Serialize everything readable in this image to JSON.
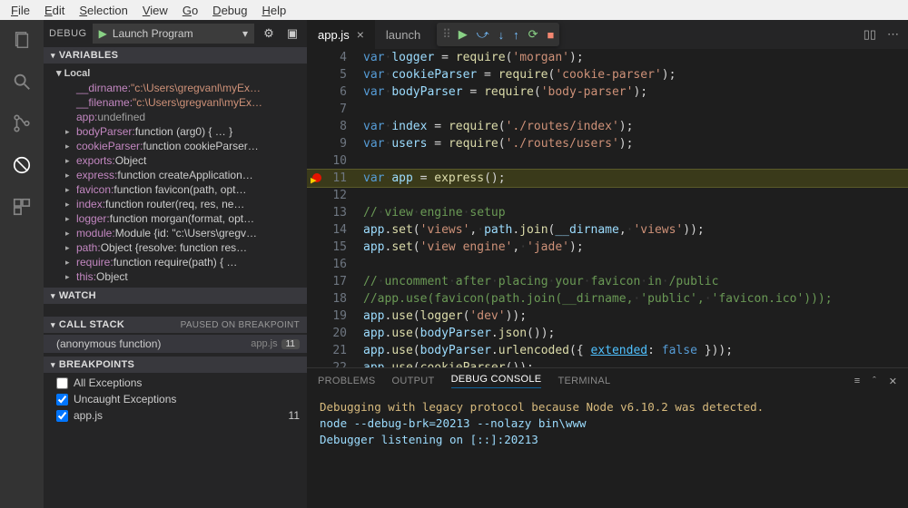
{
  "menubar": [
    "File",
    "Edit",
    "Selection",
    "View",
    "Go",
    "Debug",
    "Help"
  ],
  "debugHeader": {
    "label": "DEBUG",
    "config": "Launch Program"
  },
  "sections": {
    "variables": "VARIABLES",
    "localScope": "Local",
    "watch": "WATCH",
    "callstack": "CALL STACK",
    "callstackStatus": "PAUSED ON BREAKPOINT",
    "breakpoints": "BREAKPOINTS"
  },
  "variables": [
    {
      "t": false,
      "n": "__dirname",
      "v": "\"c:\\Users\\gregvanl\\myEx…",
      "c": "vv"
    },
    {
      "t": false,
      "n": "__filename",
      "v": "\"c:\\Users\\gregvanl\\myEx…",
      "c": "vv"
    },
    {
      "t": false,
      "n": "app",
      "v": "undefined",
      "c": "vu"
    },
    {
      "t": true,
      "n": "bodyParser",
      "v": "function (arg0) { … }",
      "c": "vo"
    },
    {
      "t": true,
      "n": "cookieParser",
      "v": "function cookieParser…",
      "c": "vo"
    },
    {
      "t": true,
      "n": "exports",
      "v": "Object",
      "c": "vo"
    },
    {
      "t": true,
      "n": "express",
      "v": "function createApplication…",
      "c": "vo"
    },
    {
      "t": true,
      "n": "favicon",
      "v": "function favicon(path, opt…",
      "c": "vo"
    },
    {
      "t": true,
      "n": "index",
      "v": "function router(req, res, ne…",
      "c": "vo"
    },
    {
      "t": true,
      "n": "logger",
      "v": "function morgan(format, opt…",
      "c": "vo"
    },
    {
      "t": true,
      "n": "module",
      "v": "Module {id: \"c:\\Users\\gregv…",
      "c": "vo"
    },
    {
      "t": true,
      "n": "path",
      "v": "Object {resolve: function res…",
      "c": "vo"
    },
    {
      "t": true,
      "n": "require",
      "v": "function require(path) { …",
      "c": "vo"
    },
    {
      "t": true,
      "n": "this",
      "v": "Object",
      "c": "vo"
    }
  ],
  "callstack": {
    "fn": "(anonymous function)",
    "loc": "app.js",
    "line": "11"
  },
  "breakpoints": [
    {
      "checked": false,
      "label": "All Exceptions"
    },
    {
      "checked": true,
      "label": "Uncaught Exceptions"
    },
    {
      "checked": true,
      "label": "app.js",
      "line": "11"
    }
  ],
  "tabs": [
    {
      "label": "app.js",
      "active": true
    },
    {
      "label": "launch",
      "active": false
    }
  ],
  "code": [
    {
      "n": 4,
      "h": "<span class='hl-kw'>var</span><span class='hl-ws'>·</span><span class='hl-var'>logger</span> = <span class='hl-fn'>require</span>(<span class='hl-str'>'morgan'</span>);"
    },
    {
      "n": 5,
      "h": "<span class='hl-kw'>var</span><span class='hl-ws'>·</span><span class='hl-var'>cookieParser</span> = <span class='hl-fn'>require</span>(<span class='hl-str'>'cookie-parser'</span>);"
    },
    {
      "n": 6,
      "h": "<span class='hl-kw'>var</span><span class='hl-ws'>·</span><span class='hl-var'>bodyParser</span> = <span class='hl-fn'>require</span>(<span class='hl-str'>'body-parser'</span>);"
    },
    {
      "n": 7,
      "h": ""
    },
    {
      "n": 8,
      "h": "<span class='hl-kw'>var</span><span class='hl-ws'>·</span><span class='hl-var'>index</span> = <span class='hl-fn'>require</span>(<span class='hl-str'>'./routes/index'</span>);"
    },
    {
      "n": 9,
      "h": "<span class='hl-kw'>var</span><span class='hl-ws'>·</span><span class='hl-var'>users</span> = <span class='hl-fn'>require</span>(<span class='hl-str'>'./routes/users'</span>);"
    },
    {
      "n": 10,
      "h": ""
    },
    {
      "n": 11,
      "cur": true,
      "bp": true,
      "h": "<span class='hl-kw'>var</span><span class='hl-ws'>·</span><span class='hl-var'>app</span> = <span class='hl-fn'>express</span>();"
    },
    {
      "n": 12,
      "h": ""
    },
    {
      "n": 13,
      "h": "<span class='hl-com'>//<span class='hl-ws'>·</span>view<span class='hl-ws'>·</span>engine<span class='hl-ws'>·</span>setup</span>"
    },
    {
      "n": 14,
      "h": "<span class='hl-var'>app</span>.<span class='hl-fn'>set</span>(<span class='hl-str'>'views'</span>,<span class='hl-ws'>·</span><span class='hl-var'>path</span>.<span class='hl-fn'>join</span>(<span class='hl-var'>__dirname</span>,<span class='hl-ws'>·</span><span class='hl-str'>'views'</span>));"
    },
    {
      "n": 15,
      "h": "<span class='hl-var'>app</span>.<span class='hl-fn'>set</span>(<span class='hl-str'>'view engine'</span>,<span class='hl-ws'>·</span><span class='hl-str'>'jade'</span>);"
    },
    {
      "n": 16,
      "h": ""
    },
    {
      "n": 17,
      "h": "<span class='hl-com'>//<span class='hl-ws'>·</span>uncomment<span class='hl-ws'>·</span>after<span class='hl-ws'>·</span>placing<span class='hl-ws'>·</span>your<span class='hl-ws'>·</span>favicon<span class='hl-ws'>·</span>in<span class='hl-ws'>·</span>/public</span>"
    },
    {
      "n": 18,
      "h": "<span class='hl-com'>//app.use(favicon(path.join(__dirname,<span class='hl-ws'>·</span>'public',<span class='hl-ws'>·</span>'favicon.ico')));</span>"
    },
    {
      "n": 19,
      "h": "<span class='hl-var'>app</span>.<span class='hl-fn'>use</span>(<span class='hl-fn'>logger</span>(<span class='hl-str'>'dev'</span>));"
    },
    {
      "n": 20,
      "h": "<span class='hl-var'>app</span>.<span class='hl-fn'>use</span>(<span class='hl-var'>bodyParser</span>.<span class='hl-fn'>json</span>());"
    },
    {
      "n": 21,
      "h": "<span class='hl-var'>app</span>.<span class='hl-fn'>use</span>(<span class='hl-var'>bodyParser</span>.<span class='hl-fn'>urlencoded</span>({ <span class='hl-link'>extended</span>: <span class='hl-kw'>false</span> }));"
    },
    {
      "n": 22,
      "h": "<span class='hl-var'>app</span>.<span class='hl-fn'>use</span>(<span class='hl-fn'>cookieParser</span>());"
    }
  ],
  "panel": {
    "tabs": [
      "PROBLEMS",
      "OUTPUT",
      "DEBUG CONSOLE",
      "TERMINAL"
    ],
    "active": 2,
    "lines": [
      {
        "c": "p-yellow",
        "t": "Debugging with legacy protocol because Node v6.10.2 was detected."
      },
      {
        "c": "p-info",
        "t": "node --debug-brk=20213 --nolazy bin\\www"
      },
      {
        "c": "p-info",
        "t": "Debugger listening on [::]:20213"
      }
    ]
  }
}
